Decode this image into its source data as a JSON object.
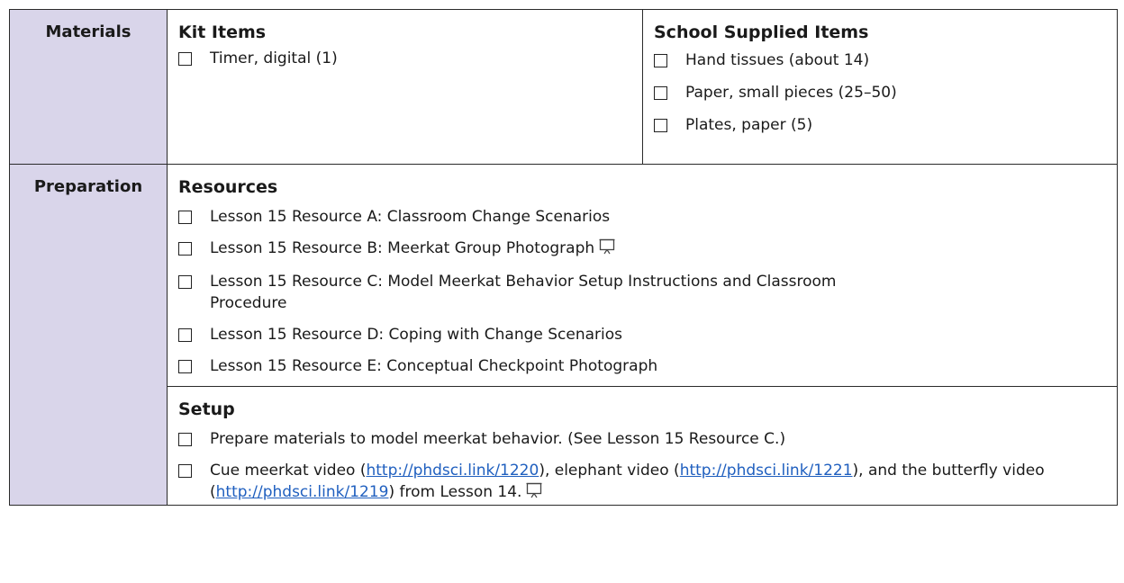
{
  "materials": {
    "label": "Materials",
    "kit": {
      "heading": "Kit Items",
      "items": [
        "Timer, digital (1)"
      ]
    },
    "school": {
      "heading": "School Supplied Items",
      "items": [
        "Hand tissues (about 14)",
        "Paper, small pieces (25–50)",
        "Plates, paper (5)"
      ]
    }
  },
  "preparation": {
    "label": "Preparation",
    "resources": {
      "heading": "Resources",
      "items": [
        "Lesson 15 Resource A: Classroom Change Scenarios",
        "Lesson 15 Resource B: Meerkat Group Photograph",
        "Lesson 15 Resource C: Model Meerkat Behavior Setup Instructions and Classroom Procedure",
        "Lesson 15 Resource D: Coping with Change Scenarios",
        "Lesson 15 Resource E: Conceptual Checkpoint Photograph"
      ]
    },
    "setup": {
      "heading": "Setup",
      "item1": "Prepare materials to model meerkat behavior. (See Lesson 15 Resource C.)",
      "item2": {
        "part1": "Cue meerkat video (",
        "link1": "http://phdsci.link/1220",
        "part2": "), elephant video (",
        "link2": "http://phdsci.link/1221",
        "part3": "), and the butterfly video (",
        "link3": "http://phdsci.link/1219",
        "part4": ") from Lesson 14."
      }
    }
  },
  "icons": {
    "checkbox": "checkbox-icon",
    "projector": "projector-icon"
  },
  "colors": {
    "label_bg": "#d9d5ea",
    "link": "#1f5fbf"
  }
}
